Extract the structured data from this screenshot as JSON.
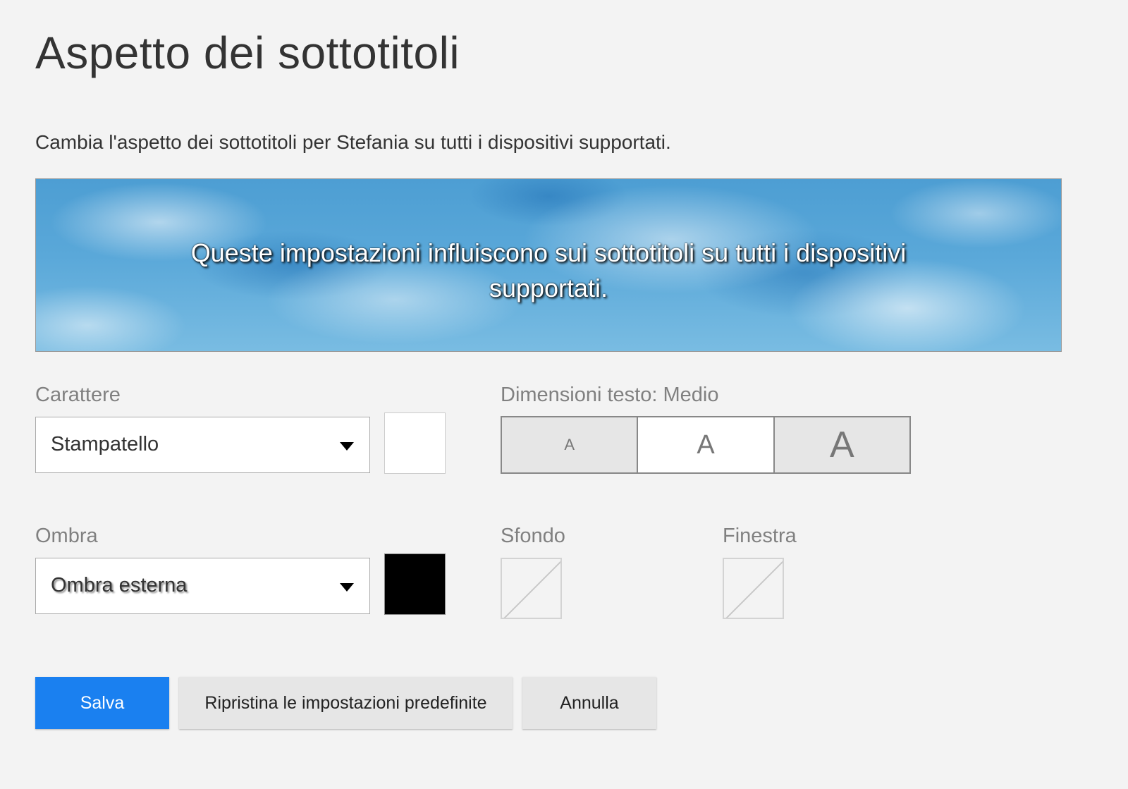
{
  "header": {
    "title": "Aspetto dei sottotitoli",
    "description": "Cambia l'aspetto dei sottotitoli per Stefania su tutti i dispositivi supportati."
  },
  "preview": {
    "text": "Queste impostazioni influiscono sui sottotitoli su tutti i dispositivi supportati."
  },
  "font": {
    "label": "Carattere",
    "selected": "Stampatello",
    "color": "#ffffff"
  },
  "text_size": {
    "label": "Dimensioni testo: Medio",
    "options": [
      "A",
      "A",
      "A"
    ],
    "selected_index": 1
  },
  "shadow": {
    "label": "Ombra",
    "selected": "Ombra esterna",
    "color": "#000000"
  },
  "background": {
    "label": "Sfondo",
    "color": "none"
  },
  "window": {
    "label": "Finestra",
    "color": "none"
  },
  "actions": {
    "save": "Salva",
    "reset": "Ripristina le impostazioni predefinite",
    "cancel": "Annulla"
  },
  "colors": {
    "accent": "#1a80f0",
    "page_background": "#f3f3f3"
  }
}
